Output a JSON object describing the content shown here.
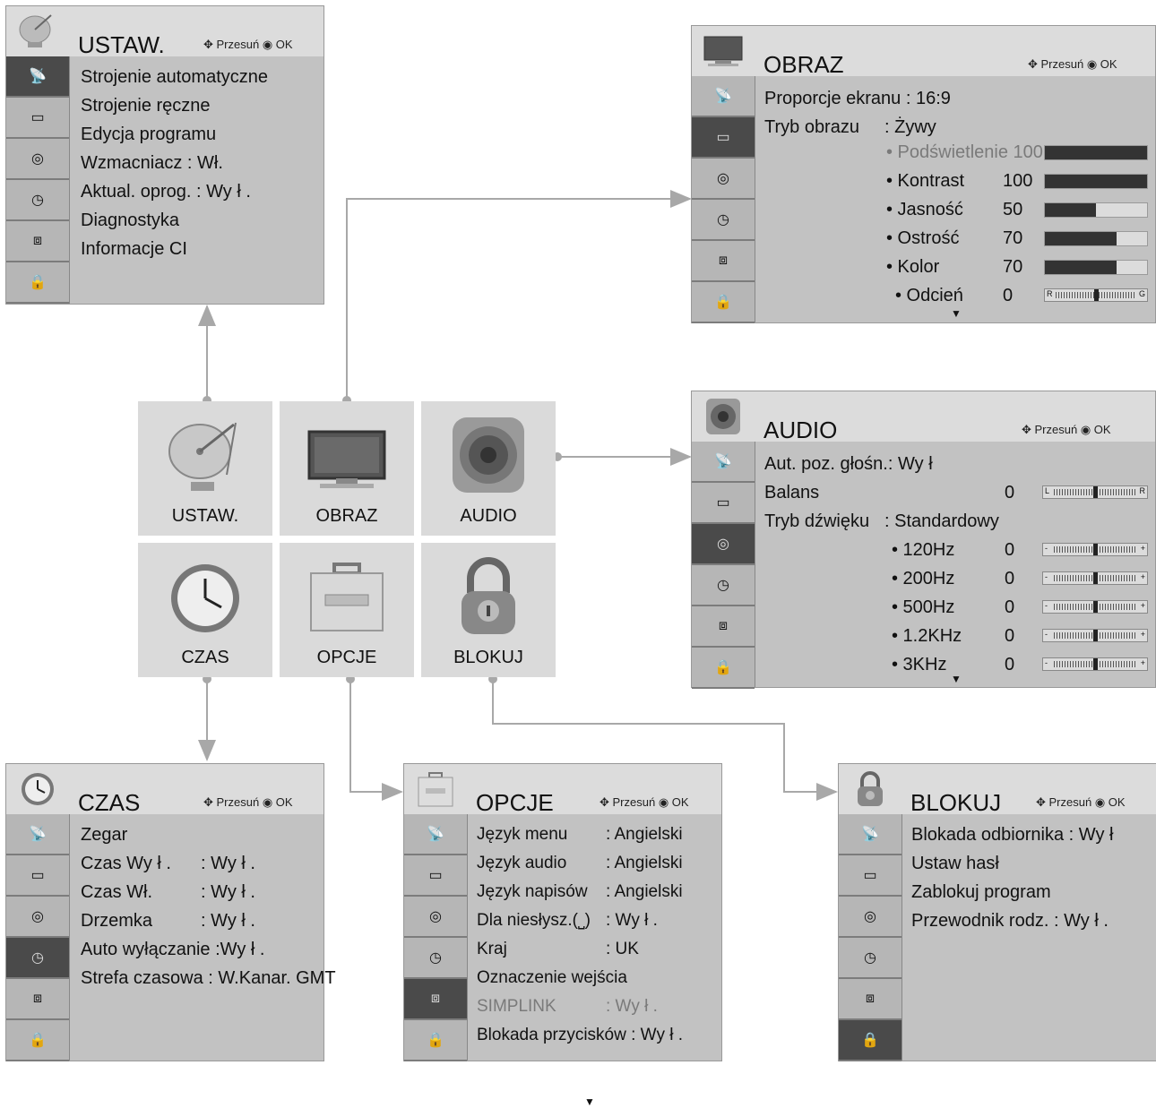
{
  "nav": {
    "move": "Przesuń",
    "ok": "OK"
  },
  "tiles": {
    "setup": "USTAW.",
    "picture": "OBRAZ",
    "audio": "AUDIO",
    "time": "CZAS",
    "option": "OPCJE",
    "lock": "BLOKUJ"
  },
  "setup": {
    "title": "USTAW.",
    "items": [
      "Strojenie automatyczne",
      "Strojenie ręczne",
      "Edycja programu",
      "Wzmacniacz   :  Wł.",
      "Aktual. oprog.  : Wy ł .",
      "Diagnostyka",
      "Informacje CI"
    ]
  },
  "picture": {
    "title": "OBRAZ",
    "aspect": "Proporcje ekranu : 16:9",
    "mode_label": "Tryb obrazu",
    "mode_value": ": Żywy",
    "settings": [
      {
        "name": "• Podświetlenie 100",
        "value": "",
        "level": 1.0,
        "dim": true
      },
      {
        "name": "• Kontrast",
        "value": "100",
        "level": 1.0
      },
      {
        "name": "• Jasność",
        "value": "50",
        "level": 0.5
      },
      {
        "name": "• Ostrość",
        "value": "70",
        "level": 0.7
      },
      {
        "name": "• Kolor",
        "value": "70",
        "level": 0.7
      }
    ],
    "tint": {
      "name": "• Odcień",
      "value": "0",
      "left": "R",
      "right": "G"
    }
  },
  "audio": {
    "title": "AUDIO",
    "avl": "Aut. poz. głośn.: Wy  ł",
    "balance_label": "Balans",
    "balance_value": "0",
    "balance_left": "L",
    "balance_right": "R",
    "mode_label": "Tryb dźwięku",
    "mode_value": ": Standardowy",
    "bands": [
      {
        "name": "• 120Hz",
        "value": "0"
      },
      {
        "name": "• 200Hz",
        "value": "0"
      },
      {
        "name": "• 500Hz",
        "value": "0"
      },
      {
        "name": "• 1.2KHz",
        "value": "0"
      },
      {
        "name": "• 3KHz",
        "value": "0"
      }
    ],
    "eq_left": "-",
    "eq_right": "+"
  },
  "time": {
    "title": "CZAS",
    "items": [
      {
        "label": "Zegar",
        "value": ""
      },
      {
        "label": "Czas Wy ł .",
        "value": ": Wy ł ."
      },
      {
        "label": "Czas  Wł.",
        "value": ": Wy ł ."
      },
      {
        "label": "Drzemka",
        "value": ": Wy ł ."
      },
      {
        "label": "Auto wyłączanie :Wy ł .",
        "value": ""
      },
      {
        "label": "Strefa czasowa  : W.Kanar. GMT",
        "value": ""
      }
    ]
  },
  "option": {
    "title": "OPCJE",
    "items": [
      {
        "label": "Język menu",
        "value": ": Angielski",
        "dim": false
      },
      {
        "label": "Język  audio",
        "value": ": Angielski",
        "dim": false
      },
      {
        "label": "Język  napisów",
        "value": ": Angielski",
        "dim": false
      },
      {
        "label": "Dla niesłysz.(⎵)",
        "value": ": Wy ł .",
        "dim": false
      },
      {
        "label": "Kraj",
        "value": ": UK",
        "dim": false
      },
      {
        "label": "Oznaczenie wejścia",
        "value": "",
        "dim": false
      },
      {
        "label": "SIMPLINK",
        "value": ": Wy ł .",
        "dim": true
      },
      {
        "label": "Blokada przycisków : Wy ł .",
        "value": "",
        "dim": false
      }
    ]
  },
  "lock": {
    "title": "BLOKUJ",
    "items": [
      "Blokada odbiornika   : Wy  ł",
      "Ustaw  hasł",
      "Zablokuj program",
      "Przewodnik rodz.  : Wy ł ."
    ]
  },
  "colors": {
    "panel": "#c9c9c9",
    "sidebar_selected": "#4a4a4a",
    "connector": "#a8a8a8"
  }
}
